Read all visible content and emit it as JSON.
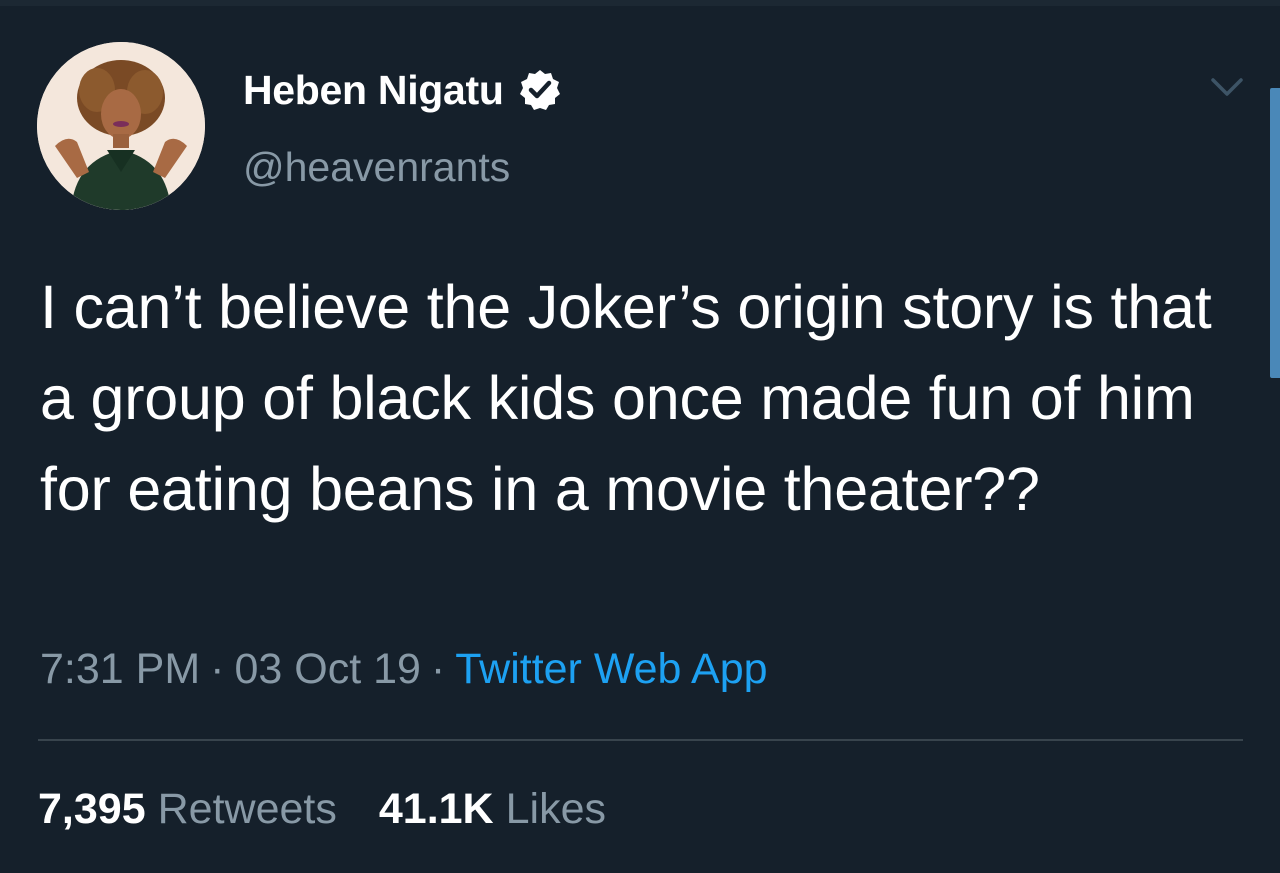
{
  "user": {
    "display_name": "Heben Nigatu",
    "handle": "@heavenrants",
    "verified": true
  },
  "tweet": {
    "text": "I can’t believe the Joker’s origin story is that a group of black kids once made fun of him for eating beans in a movie theater??",
    "time": "7:31 PM",
    "date": "03 Oct 19",
    "separator": "·",
    "source": "Twitter Web App"
  },
  "stats": {
    "retweets_count": "7,395",
    "retweets_label": "Retweets",
    "likes_count": "41.1K",
    "likes_label": "Likes"
  },
  "icons": {
    "verified": "verified-badge-icon",
    "menu": "chevron-down-icon"
  },
  "colors": {
    "background": "#15202b",
    "text_primary": "#ffffff",
    "text_secondary": "#8899a6",
    "accent": "#1da1f2",
    "divider": "#38444d"
  }
}
